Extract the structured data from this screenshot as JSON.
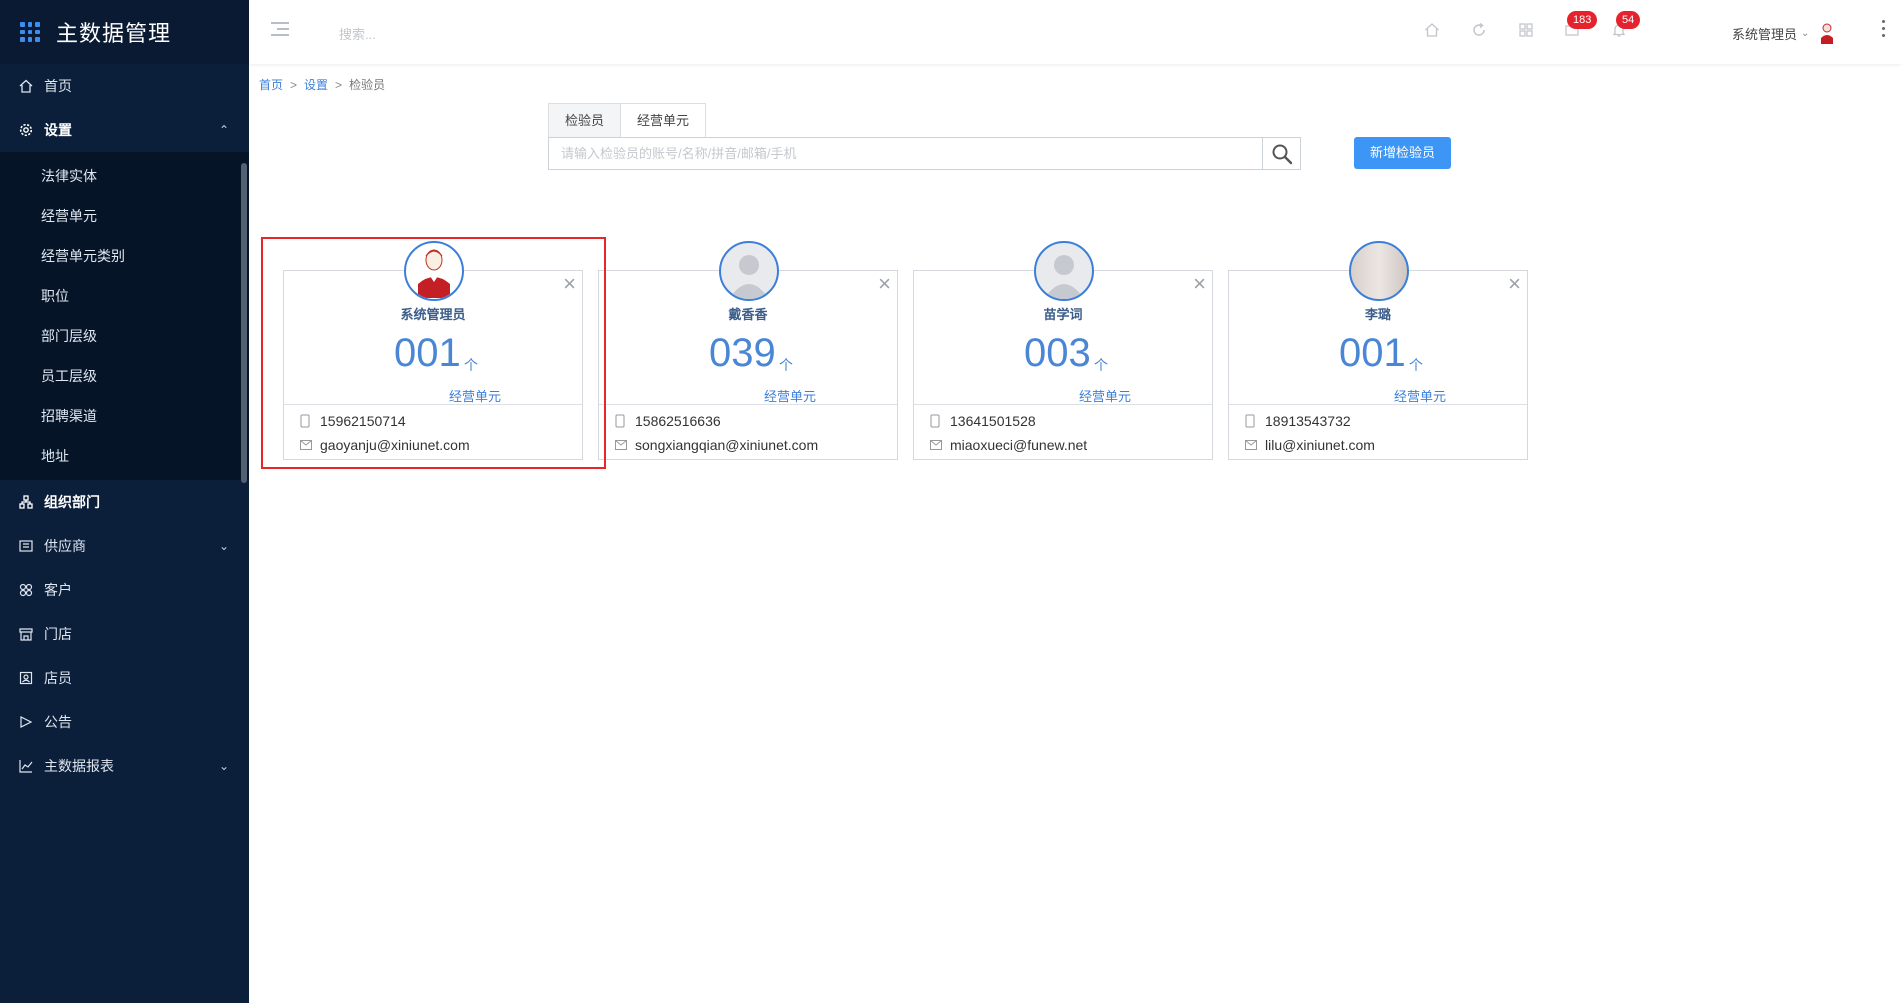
{
  "app": {
    "title": "主数据管理"
  },
  "sidebar": {
    "items": [
      {
        "label": "首页",
        "icon": "home-icon"
      },
      {
        "label": "设置",
        "icon": "gear-icon",
        "expanded": true,
        "children": [
          "法律实体",
          "经营单元",
          "经营单元类别",
          "职位",
          "部门层级",
          "员工层级",
          "招聘渠道",
          "地址"
        ]
      },
      {
        "label": "组织部门",
        "icon": "org-icon"
      },
      {
        "label": "供应商",
        "icon": "supplier-icon",
        "hasCaret": true
      },
      {
        "label": "客户",
        "icon": "customer-icon"
      },
      {
        "label": "门店",
        "icon": "store-icon"
      },
      {
        "label": "店员",
        "icon": "clerk-icon"
      },
      {
        "label": "公告",
        "icon": "announce-icon"
      },
      {
        "label": "主数据报表",
        "icon": "chart-icon",
        "hasCaret": true
      }
    ]
  },
  "header": {
    "search_placeholder": "搜索...",
    "badges": {
      "messages": "183",
      "notifications": "54"
    },
    "user": "系统管理员"
  },
  "breadcrumb": {
    "home": "首页",
    "settings": "设置",
    "current": "检验员"
  },
  "tabs": [
    {
      "label": "检验员",
      "active": true
    },
    {
      "label": "经营单元",
      "active": false
    }
  ],
  "search": {
    "placeholder": "请输入检验员的账号/名称/拼音/邮箱/手机",
    "value": ""
  },
  "add_button": "新增检验员",
  "cards": [
    {
      "name": "系统管理员",
      "count": "001",
      "unit": "个",
      "label": "经营单元",
      "phone": "15962150714",
      "email": "gaoyanju@xiniunet.com",
      "avatar": "admin"
    },
    {
      "name": "戴香香",
      "count": "039",
      "unit": "个",
      "label": "经营单元",
      "phone": "15862516636",
      "email": "songxiangqian@xiniunet.com",
      "avatar": "default"
    },
    {
      "name": "苗学词",
      "count": "003",
      "unit": "个",
      "label": "经营单元",
      "phone": "13641501528",
      "email": "miaoxueci@funew.net",
      "avatar": "default"
    },
    {
      "name": "李璐",
      "count": "001",
      "unit": "个",
      "label": "经营单元",
      "phone": "18913543732",
      "email": "lilu@xiniunet.com",
      "avatar": "photo"
    }
  ],
  "colors": {
    "sidebar": "#0b1e3a",
    "accent": "#3d96f5",
    "highlight": "#e8262a",
    "badge": "#e6222d"
  }
}
